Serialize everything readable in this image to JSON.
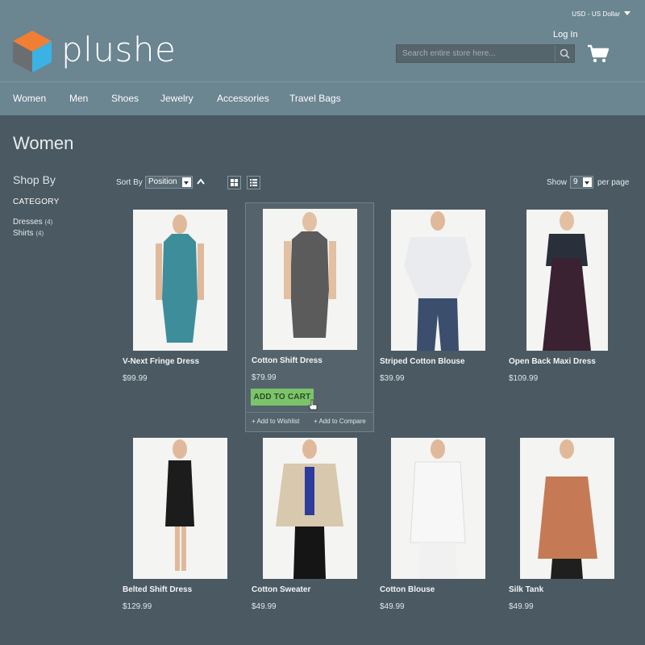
{
  "header": {
    "currency": "USD - US Dollar",
    "logo_text": "plushe",
    "login": "Log In",
    "search_placeholder": "Search entire store here..."
  },
  "nav": {
    "items": [
      "Women",
      "Men",
      "Shoes",
      "Jewelry",
      "Accessories",
      "Travel Bags"
    ]
  },
  "page": {
    "title": "Women"
  },
  "sidebar": {
    "shop_by": "Shop By",
    "category_title": "CATEGORY",
    "filters": [
      {
        "label": "Dresses",
        "count": "(4)"
      },
      {
        "label": "Shirts",
        "count": "(4)"
      }
    ]
  },
  "toolbar": {
    "sort_label": "Sort By",
    "sort_value": "Position",
    "show_label": "Show",
    "show_value": "9",
    "per_page_label": "per page"
  },
  "products": [
    {
      "name": "V-Next Fringe Dress",
      "price": "$99.99",
      "garment_color": "#3d8e9a"
    },
    {
      "name": "Cotton Shift Dress",
      "price": "$79.99",
      "garment_color": "#5b5b5b"
    },
    {
      "name": "Striped Cotton Blouse",
      "price": "$39.99",
      "garment_color": "#e9ebee"
    },
    {
      "name": "Open Back Maxi Dress",
      "price": "$109.99",
      "garment_color": "#3a2232"
    },
    {
      "name": "Belted Shift Dress",
      "price": "$129.99",
      "garment_color": "#1c1c1c"
    },
    {
      "name": "Cotton Sweater",
      "price": "$49.99",
      "garment_color": "#d8c8ad"
    },
    {
      "name": "Cotton Blouse",
      "price": "$49.99",
      "garment_color": "#f7f7f8"
    },
    {
      "name": "Silk Tank",
      "price": "$49.99",
      "garment_color": "#c57a55"
    }
  ],
  "hover": {
    "add_to_cart": "ADD TO CART",
    "add_to_wishlist": "+ Add to Wishlist",
    "add_to_compare": "+ Add to Compare"
  },
  "colors": {
    "header_bg": "#6b8591",
    "body_bg": "#4a5962",
    "add_to_cart": "#7bc46a",
    "logo_orange": "#f07f34",
    "logo_blue": "#3ab2e3",
    "logo_gray": "#6b6e70"
  }
}
